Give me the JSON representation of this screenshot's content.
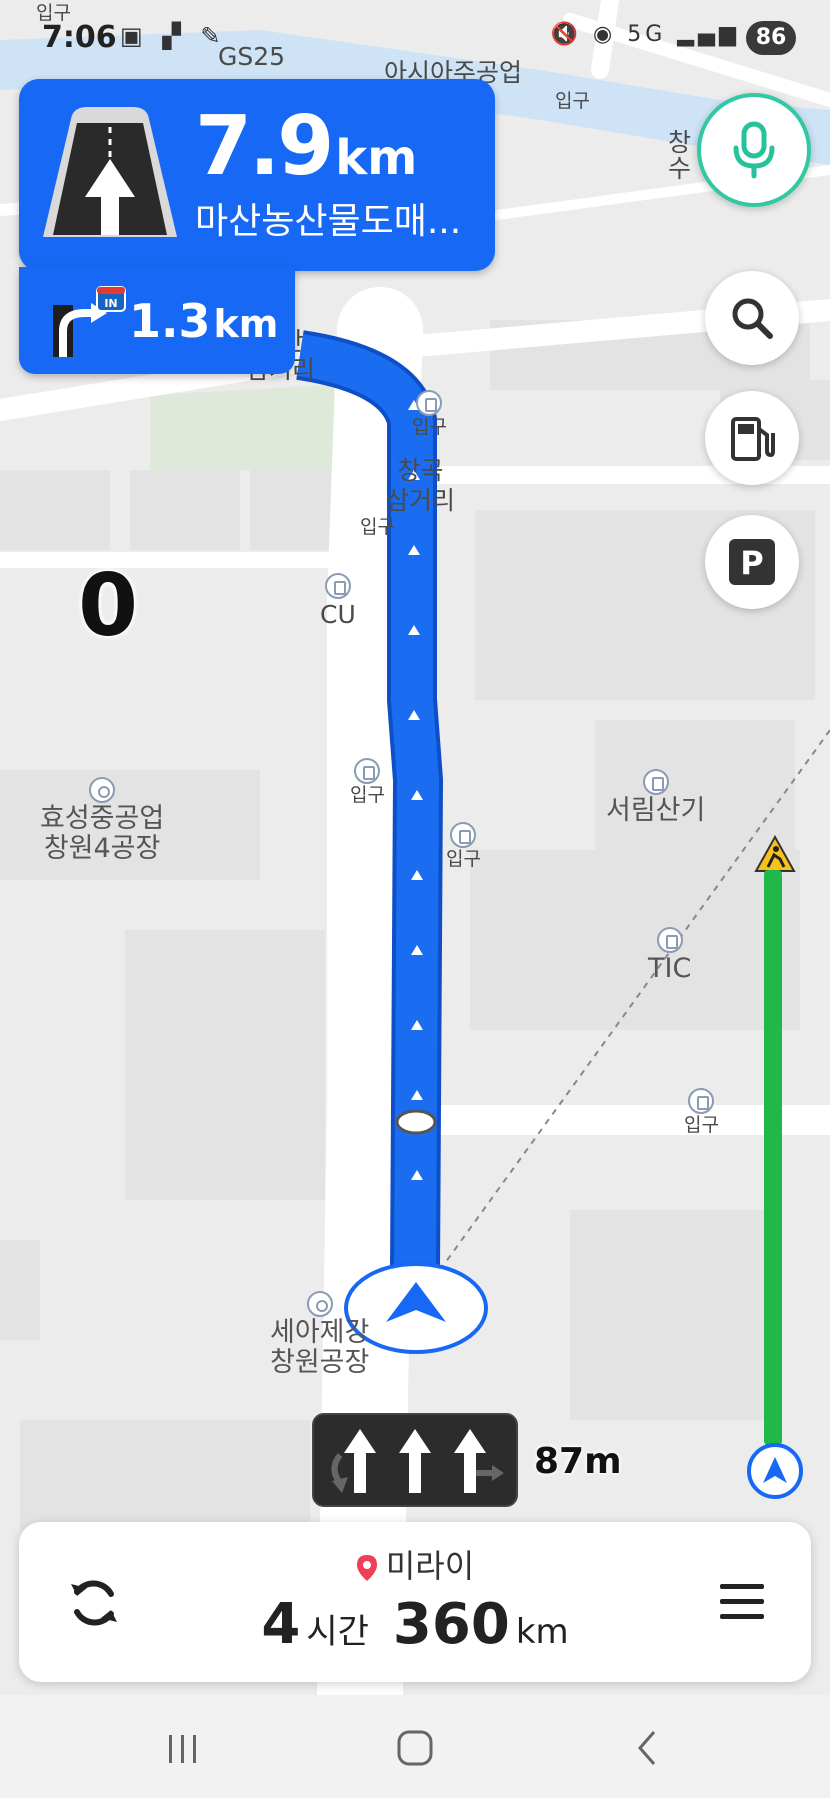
{
  "status_bar": {
    "time": "7:06",
    "left_icons": "▣ ▞ ✎",
    "right_icons": "🔇 ◉ 5G ▂▄▆",
    "battery": "86"
  },
  "map": {
    "labels": {
      "gs25": "GS25",
      "asia": "아시아주공업",
      "ipgu_top_left": "입구",
      "ipgu_top_right": "입구",
      "chang_su": "창\n수",
      "sandan": "산단\n삼거리",
      "ipgu_1": "입구",
      "changgok": "창곡\n삼거리",
      "ipgu_2": "입구",
      "cu": "CU",
      "ipgu_3": "입구",
      "ipgu_4": "입구",
      "seorim": "서림산기",
      "hyosung": "효성중공업\n창원4공장",
      "tic": "TIC",
      "ipgu_5": "입구",
      "seah": "세아제강\n창원공장"
    }
  },
  "guidance": {
    "distance_value": "7.9",
    "distance_unit": "km",
    "destination": "마산농산물도매...",
    "next_distance_value": "1.3",
    "next_distance_unit": "km",
    "next_badge": "IN"
  },
  "speed": "0",
  "lane": {
    "distance": "87m"
  },
  "trip": {
    "destination": "미라이",
    "hours": "4",
    "hours_unit": "시간",
    "distance_km": "360",
    "distance_unit": "km"
  },
  "icons": {
    "mic": "mic-icon",
    "search": "search-icon",
    "fuel": "fuel-station-icon",
    "parking": "parking-icon",
    "refresh": "reroute-icon",
    "menu": "menu-icon"
  },
  "colors": {
    "primary_blue": "#1769f5",
    "route_blue": "#1a6cf0",
    "progress_green": "#1fb849",
    "mic_teal": "#31c9a4"
  }
}
